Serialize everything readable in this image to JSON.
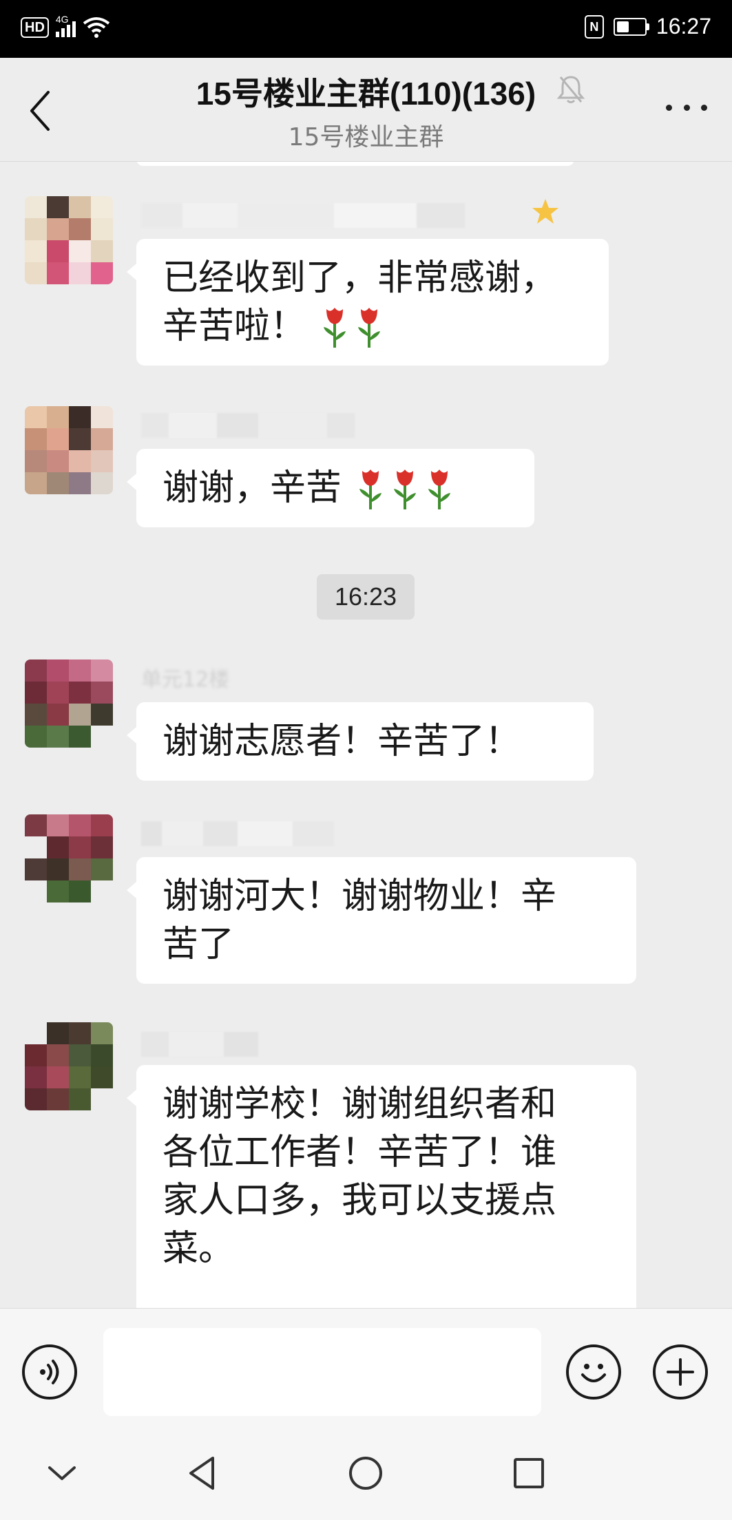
{
  "status_bar": {
    "hd_badge": "HD",
    "network": "4G",
    "nfc": "N",
    "battery_level": 0.45,
    "time": "16:27"
  },
  "header": {
    "title": "15号楼业主群(110)(136)",
    "subtitle": "15号楼业主群",
    "back_icon": "chevron-left-icon",
    "mute_icon": "bell-off-icon",
    "more_icon": "more-dots-icon"
  },
  "messages": [
    {
      "sender": "",
      "text_lines": [
        "已经收到了，非常感谢，",
        "辛苦啦！"
      ],
      "rose_count": 2
    },
    {
      "sender": "",
      "text_lines": [
        "谢谢，辛苦"
      ],
      "rose_count": 3
    },
    {
      "sender": "单元12楼",
      "text_lines": [
        "谢谢志愿者！辛苦了！"
      ],
      "rose_count": 0
    },
    {
      "sender": "",
      "text_lines": [
        "谢谢河大！谢谢物业！辛",
        "苦了"
      ],
      "rose_count": 0
    },
    {
      "sender": "",
      "text_lines": [
        "谢谢学校！谢谢组织者和",
        "各位工作者！辛苦了！谁",
        "家人口多，我可以支援点",
        "菜。"
      ],
      "rose_count": 0
    }
  ],
  "timestamp": "16:23",
  "input_bar": {
    "voice_icon": "voice-icon",
    "input_value": "",
    "emoji_icon": "emoji-icon",
    "plus_icon": "plus-icon"
  },
  "nav_bar": {
    "collapse_icon": "chevron-down-icon",
    "back_icon": "triangle-back-icon",
    "home_icon": "circle-home-icon",
    "recents_icon": "square-recents-icon"
  },
  "colors": {
    "status_bar_bg": "#000000",
    "chat_bg": "#ededed",
    "bubble_bg": "#ffffff",
    "rose": "#d9302a",
    "leaf": "#3f8f2e"
  }
}
